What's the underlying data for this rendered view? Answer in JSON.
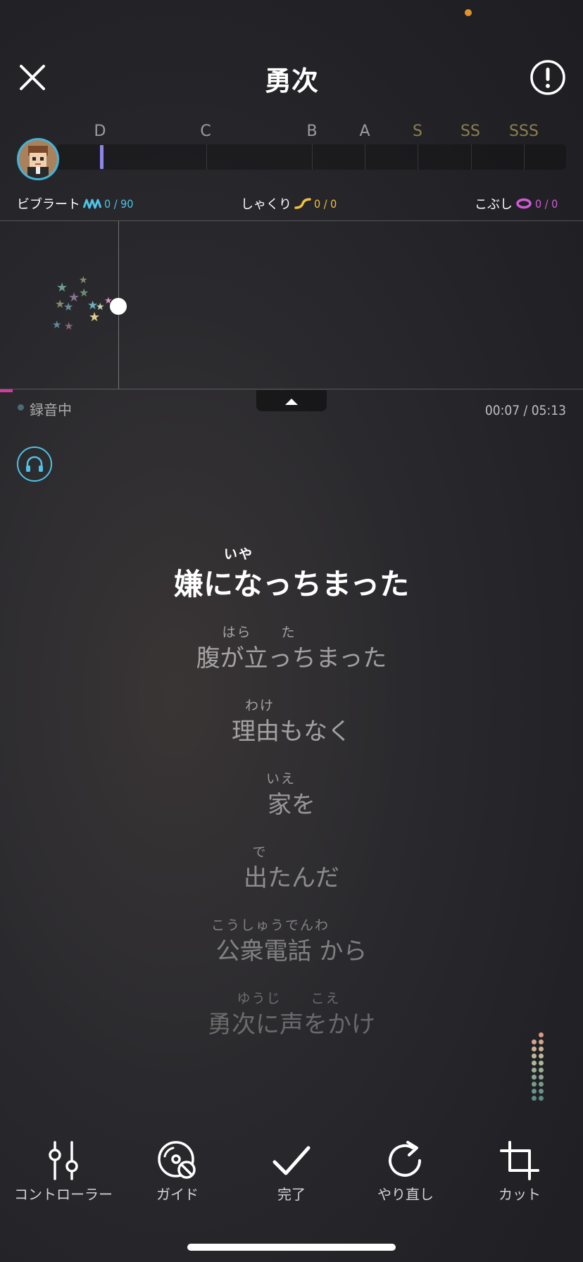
{
  "header": {
    "title": "勇次"
  },
  "grades": [
    "D",
    "C",
    "B",
    "A",
    "S",
    "SS",
    "SSS"
  ],
  "techniques": {
    "vibrato": {
      "label": "ビブラート",
      "count": "0 / 90",
      "color": "#4fc3e6"
    },
    "shakuri": {
      "label": "しゃくり",
      "count": "0 / 0",
      "color": "#f0c040"
    },
    "kobushi": {
      "label": "こぶし",
      "count": "0 / 0",
      "color": "#d05cd8"
    }
  },
  "status": {
    "recording_label": "録音中",
    "time": "00:07 / 05:13"
  },
  "lyrics": [
    {
      "ruby": "いや",
      "text": "嫌になっちまった",
      "current": true
    },
    {
      "ruby": "はら　　た",
      "text": "腹が立っちまった",
      "current": false
    },
    {
      "ruby": "わけ",
      "text": "理由もなく",
      "current": false
    },
    {
      "ruby": "いえ",
      "text": "家を",
      "current": false
    },
    {
      "ruby": "で",
      "text": "出たんだ",
      "current": false
    },
    {
      "ruby": "こうしゅうでんわ",
      "text": "公衆電話 から",
      "current": false
    },
    {
      "ruby": "ゆうじ　　こえ",
      "text": "勇次に声をかけ",
      "current": false
    }
  ],
  "toolbar": {
    "controller": "コントローラー",
    "guide": "ガイド",
    "done": "完了",
    "redo": "やり直し",
    "cut": "カット"
  },
  "icons": {
    "close": "close-icon",
    "info": "info-icon",
    "headphone": "headphone-icon",
    "expand": "chevron-up-icon"
  },
  "score_marker_grade": "D"
}
